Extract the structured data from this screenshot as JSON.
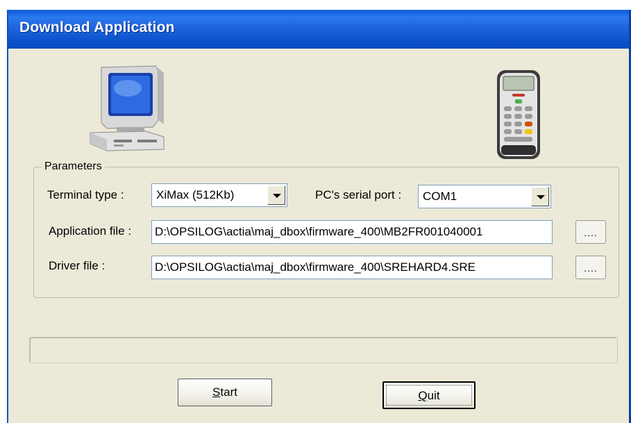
{
  "window": {
    "title": "Download Application"
  },
  "icons": {
    "pc": "computer-icon",
    "terminal": "payment-terminal-icon"
  },
  "parameters": {
    "legend": "Parameters",
    "terminal_type_label": "Terminal type :",
    "terminal_type_value": "XiMax (512Kb)",
    "serial_port_label": "PC's serial port :",
    "serial_port_value": "COM1",
    "application_file_label": "Application file :",
    "application_file_value": "D:\\OPSILOG\\actia\\maj_dbox\\firmware_400\\MB2FR001040001",
    "application_browse_label": "....",
    "driver_file_label": "Driver file :",
    "driver_file_value": "D:\\OPSILOG\\actia\\maj_dbox\\firmware_400\\SREHARD4.SRE",
    "driver_browse_label": "...."
  },
  "progress": {
    "value": 0
  },
  "buttons": {
    "start_mnemonic": "S",
    "start_rest": "tart",
    "quit_mnemonic": "Q",
    "quit_rest": "uit"
  },
  "colors": {
    "titlebar": "#0b52cc",
    "window_bg": "#ece9d8",
    "progress_fill": "#2fbf3b"
  }
}
